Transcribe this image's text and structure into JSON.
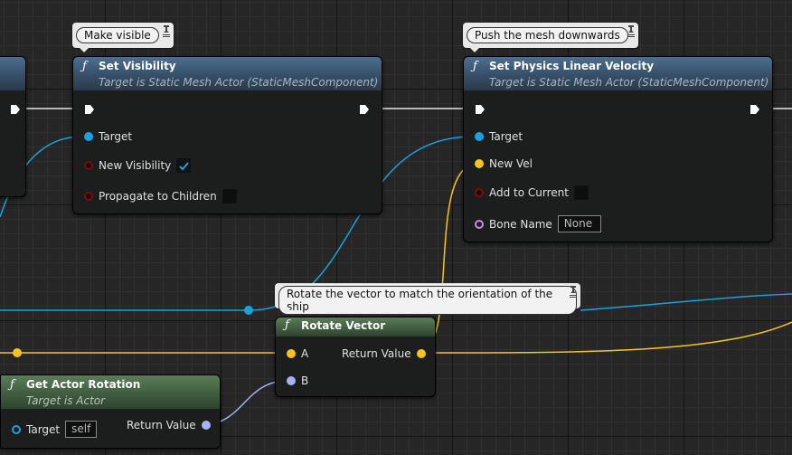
{
  "comments": {
    "make_visible": "Make visible",
    "push_down": "Push the mesh downwards",
    "rotate_vector": "Rotate the vector to match the orientation of the ship"
  },
  "set_visibility": {
    "title": "Set Visibility",
    "subtitle": "Target is Static Mesh Actor (StaticMeshComponent)",
    "pins": {
      "target": "Target",
      "new_visibility": "New Visibility",
      "propagate": "Propagate to Children"
    },
    "new_visibility_checked": true,
    "propagate_checked": false
  },
  "set_velocity": {
    "title": "Set Physics Linear Velocity",
    "subtitle": "Target is Static Mesh Actor (StaticMeshComponent)",
    "pins": {
      "target": "Target",
      "new_vel": "New Vel",
      "add_to_current": "Add to Current",
      "bone_name": "Bone Name"
    },
    "bone_name_value": "None",
    "add_to_current_checked": false
  },
  "rotate_vector": {
    "title": "Rotate Vector",
    "pins": {
      "a": "A",
      "b": "B",
      "return_value": "Return Value"
    }
  },
  "get_actor_rotation": {
    "title": "Get Actor Rotation",
    "subtitle": "Target is Actor",
    "pins": {
      "target": "Target",
      "return_value": "Return Value"
    },
    "target_value": "self"
  },
  "colors": {
    "exec_wire": "#ffffff",
    "object_wire": "#1aa1e0",
    "vector_wire": "#f5c519",
    "rotator_wire": "#a7b3f2"
  }
}
